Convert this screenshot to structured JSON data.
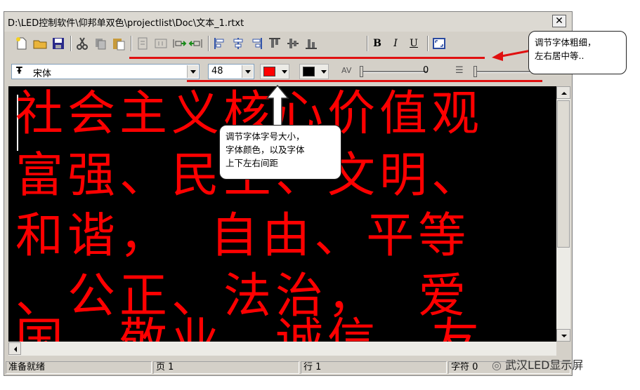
{
  "window": {
    "title": "D:\\LED控制软件\\仰邦单双色\\projectlist\\Doc\\文本_1.rtxt",
    "close_glyph": "✕"
  },
  "toolbar": {
    "bold": "B",
    "italic": "I",
    "underline": "U"
  },
  "format_bar": {
    "font_name": "宋体",
    "font_size": "48",
    "text_color": "#ff0000",
    "background_color": "#000000",
    "char_spacing_value": "0",
    "line_spacing_value": 0
  },
  "editor": {
    "lines": [
      "社会主义核心价值观",
      "富强、民主、文明、",
      "和谐，  自由、平等",
      "、公正、法治，  爱",
      "国、敬业、诚信、友"
    ],
    "text_color": "#ff0000",
    "background": "#000000"
  },
  "status_bar": {
    "ready": "准备就绪",
    "page": "页 1",
    "line": "行 1",
    "char": "字符 0"
  },
  "annotations": {
    "callout_right": "调节字体粗细，\n左右居中等..",
    "callout_center": "调节字体字号大小，\n字体颜色，以及字体\n上下左右间距",
    "accent_color": "#e01010"
  },
  "watermark": "武汉LED显示屏"
}
